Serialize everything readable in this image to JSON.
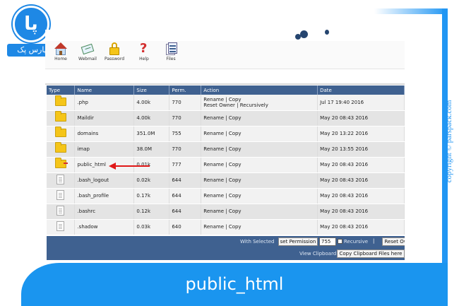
{
  "brand": {
    "logo_text": "پارس پک",
    "logo_glyph": "پا",
    "copyright": "copyright © parspack.com"
  },
  "caption": "public_html",
  "toolbar": [
    {
      "label": "Home",
      "icon": "house-icon"
    },
    {
      "label": "Webmail",
      "icon": "mail-icon"
    },
    {
      "label": "Password",
      "icon": "lock-icon"
    },
    {
      "label": "Help",
      "icon": "question-icon"
    },
    {
      "label": "Files",
      "icon": "files-icon"
    }
  ],
  "table": {
    "headers": [
      "Type",
      "Name",
      "Size",
      "Perm.",
      "Action",
      "Date"
    ],
    "rows": [
      {
        "type": "folder",
        "name": ".php",
        "size": "4.00k",
        "perm": "770",
        "action": "Rename | Copy",
        "action2": "Reset Owner | Recursively",
        "date": "Jul 17 19:40 2016"
      },
      {
        "type": "folder",
        "name": "Maildir",
        "size": "4.00k",
        "perm": "770",
        "action": "Rename | Copy",
        "action2": "",
        "date": "May 20 08:43 2016"
      },
      {
        "type": "folder",
        "name": "domains",
        "size": "351.0M",
        "perm": "755",
        "action": "Rename | Copy",
        "action2": "",
        "date": "May 20 13:22 2016"
      },
      {
        "type": "folder",
        "name": "imap",
        "size": "38.0M",
        "perm": "770",
        "action": "Rename | Copy",
        "action2": "",
        "date": "May 20 13:55 2016"
      },
      {
        "type": "folder-link",
        "name": "public_html",
        "size": "0.01k",
        "perm": "777",
        "action": "Rename | Copy",
        "action2": "",
        "date": "May 20 08:43 2016"
      },
      {
        "type": "file",
        "name": ".bash_logout",
        "size": "0.02k",
        "perm": "644",
        "action": "Rename | Copy",
        "action2": "",
        "date": "May 20 08:43 2016"
      },
      {
        "type": "file",
        "name": ".bash_profile",
        "size": "0.17k",
        "perm": "644",
        "action": "Rename | Copy",
        "action2": "",
        "date": "May 20 08:43 2016"
      },
      {
        "type": "file",
        "name": ".bashrc",
        "size": "0.12k",
        "perm": "644",
        "action": "Rename | Copy",
        "action2": "",
        "date": "May 20 08:43 2016"
      },
      {
        "type": "file",
        "name": ".shadow",
        "size": "0.03k",
        "perm": "640",
        "action": "Rename | Copy",
        "action2": "",
        "date": "May 20 08:43 2016"
      }
    ]
  },
  "actions": {
    "with_selected": "With Selected",
    "set_permission": "set Permission",
    "permission_value": "755",
    "recursive": "Recursive",
    "separator": "|",
    "reset": "Reset Ow",
    "view_clipboard": "View Clipboard",
    "copy_clipboard": "Copy Clipboard Files here"
  },
  "colors": {
    "accent": "#1a95ef",
    "table_header": "#3f6190",
    "arrow": "#e01818"
  }
}
